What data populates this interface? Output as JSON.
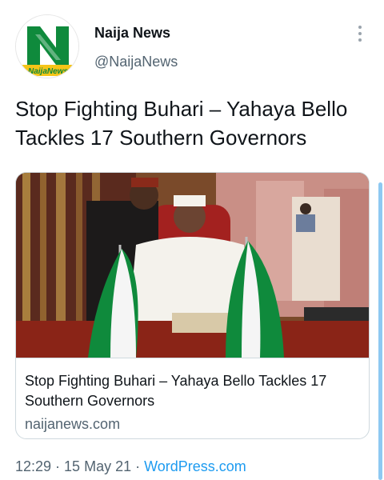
{
  "account": {
    "name": "Naija News",
    "handle": "@NaijaNews",
    "avatar_text": "NaijaNews"
  },
  "tweet": {
    "text": "Stop Fighting Buhari – Yahaya Bello Tackles 17 Southern Governors"
  },
  "link_card": {
    "title": "Stop Fighting Buhari – Yahaya Bello Tackles 17 Southern Governors",
    "domain": "naijanews.com"
  },
  "footer": {
    "time": "12:29",
    "sep1": " · ",
    "date": "15 May 21",
    "sep2": " · ",
    "source": "WordPress.com"
  },
  "colors": {
    "brand_green": "#0f8a3c",
    "link_blue": "#1d9bf0",
    "muted_text": "#536471"
  }
}
